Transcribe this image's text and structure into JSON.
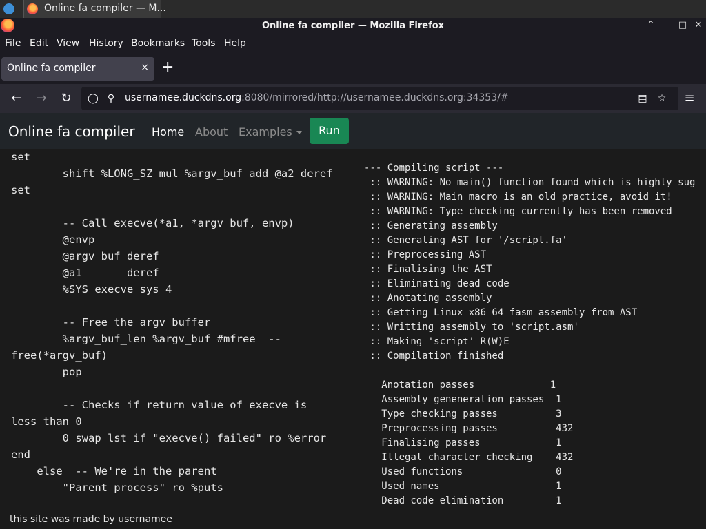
{
  "taskbar": {
    "task_title": "Online fa compiler — M..."
  },
  "window": {
    "title": "Online fa compiler — Mozilla Firefox",
    "controls": [
      "^",
      "–",
      "□",
      "✕"
    ]
  },
  "menu": [
    "File",
    "Edit",
    "View",
    "History",
    "Bookmarks",
    "Tools",
    "Help"
  ],
  "tab": {
    "title": "Online fa compiler",
    "close": "×",
    "new_tab": "+"
  },
  "nav": {
    "url_host": "usernamee.duckdns.org",
    "url_rest": ":8080/mirrored/http://usernamee.duckdns.org:34353/#"
  },
  "site": {
    "brand": "Online fa compiler",
    "links": [
      {
        "label": "Home",
        "active": true
      },
      {
        "label": "About",
        "active": false
      },
      {
        "label": "Examples",
        "active": false,
        "dropdown": true
      }
    ],
    "run_label": "Run"
  },
  "editor": {
    "code": "set\n        shift %LONG_SZ mul %argv_buf add @a2 deref\nset\n\n        -- Call execve(*a1, *argv_buf, envp)\n        @envp\n        @argv_buf deref\n        @a1       deref\n        %SYS_execve sys 4\n\n        -- Free the argv buffer\n        %argv_buf_len %argv_buf #mfree  --\nfree(*argv_buf)\n        pop\n\n        -- Checks if return value of execve is\nless than 0\n        0 swap lst if \"execve() failed\" ro %error\nend\n    else  -- We're in the parent\n        \"Parent process\" ro %puts"
  },
  "output": {
    "log": "--- Compiling script ---\n :: WARNING: No main() function found which is highly sug\n :: WARNING: Main macro is an old practice, avoid it!\n :: WARNING: Type checking currently has been removed\n :: Generating assembly\n :: Generating AST for '/script.fa'\n :: Preprocessing AST\n :: Finalising the AST\n :: Eliminating dead code\n :: Anotating assembly\n :: Getting Linux x86_64 fasm assembly from AST\n :: Writting assembly to 'script.asm'\n :: Making 'script' R(W)E\n :: Compilation finished\n\n   Anotation passes             1\n   Assembly geneneration passes  1\n   Type checking passes          3\n   Preprocessing passes          432\n   Finalising passes             1\n   Illegal character checking    432\n   Used functions                0\n   Used names                    1\n   Dead code elimination         1"
  },
  "footer": {
    "text": "this site was made by usernamee"
  },
  "colors": {
    "run_button": "#198754",
    "page_bg": "#1b1b1b",
    "header_bg": "#212529"
  }
}
